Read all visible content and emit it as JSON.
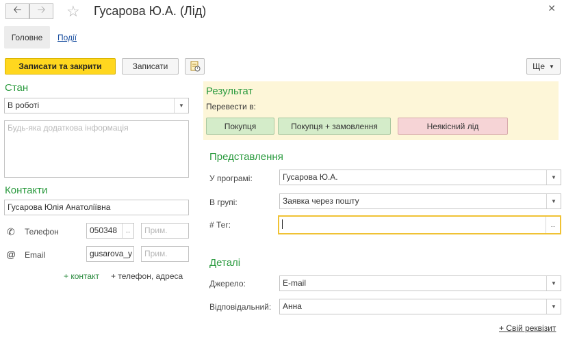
{
  "window": {
    "title": "Гусарова Ю.А. (Лід)"
  },
  "tabs": {
    "main": "Головне",
    "events": "Події"
  },
  "toolbar": {
    "save_close": "Записати та закрити",
    "save": "Записати",
    "more": "Ще"
  },
  "state": {
    "title": "Стан",
    "status_value": "В роботі",
    "info_placeholder": "Будь-яка додаткова інформація"
  },
  "contacts": {
    "title": "Контакти",
    "name_value": "Гусарова Юлія Анатоліївна",
    "phone_label": "Телефон",
    "phone_value": "050348",
    "phone_note_placeholder": "Прим.",
    "email_label": "Email",
    "email_value": "gusarova_y",
    "email_note_placeholder": "Прим.",
    "add_contact": "+ контакт",
    "add_phone_address": "+ телефон, адреса"
  },
  "result": {
    "title": "Результат",
    "convert_label": "Перевести в:",
    "btn_purchase": "Покупця",
    "btn_purchase_order": "Покупця + замовлення",
    "btn_bad_lead": "Неякісний лід"
  },
  "representation": {
    "title": "Представлення",
    "in_program_label": "У програмі:",
    "in_program_value": "Гусарова Ю.А.",
    "group_label": "В групі:",
    "group_value": "Заявка через пошту",
    "tag_label": "# Тег:",
    "tag_value": ""
  },
  "details": {
    "title": "Деталі",
    "source_label": "Джерело:",
    "source_value": "E-mail",
    "responsible_label": "Відповідальний:",
    "responsible_value": "Анна",
    "add_attribute": "+ Свій реквізит"
  },
  "colors": {
    "accent_green": "#2a9a3e",
    "primary_yellow": "#ffd71f",
    "result_bg": "#fdf6d8"
  },
  "icons": [
    "arrow-left-icon",
    "arrow-right-icon",
    "star-icon",
    "close-icon",
    "report-icon",
    "phone-icon",
    "at-icon",
    "chevron-down-icon",
    "ellipsis-icon"
  ]
}
